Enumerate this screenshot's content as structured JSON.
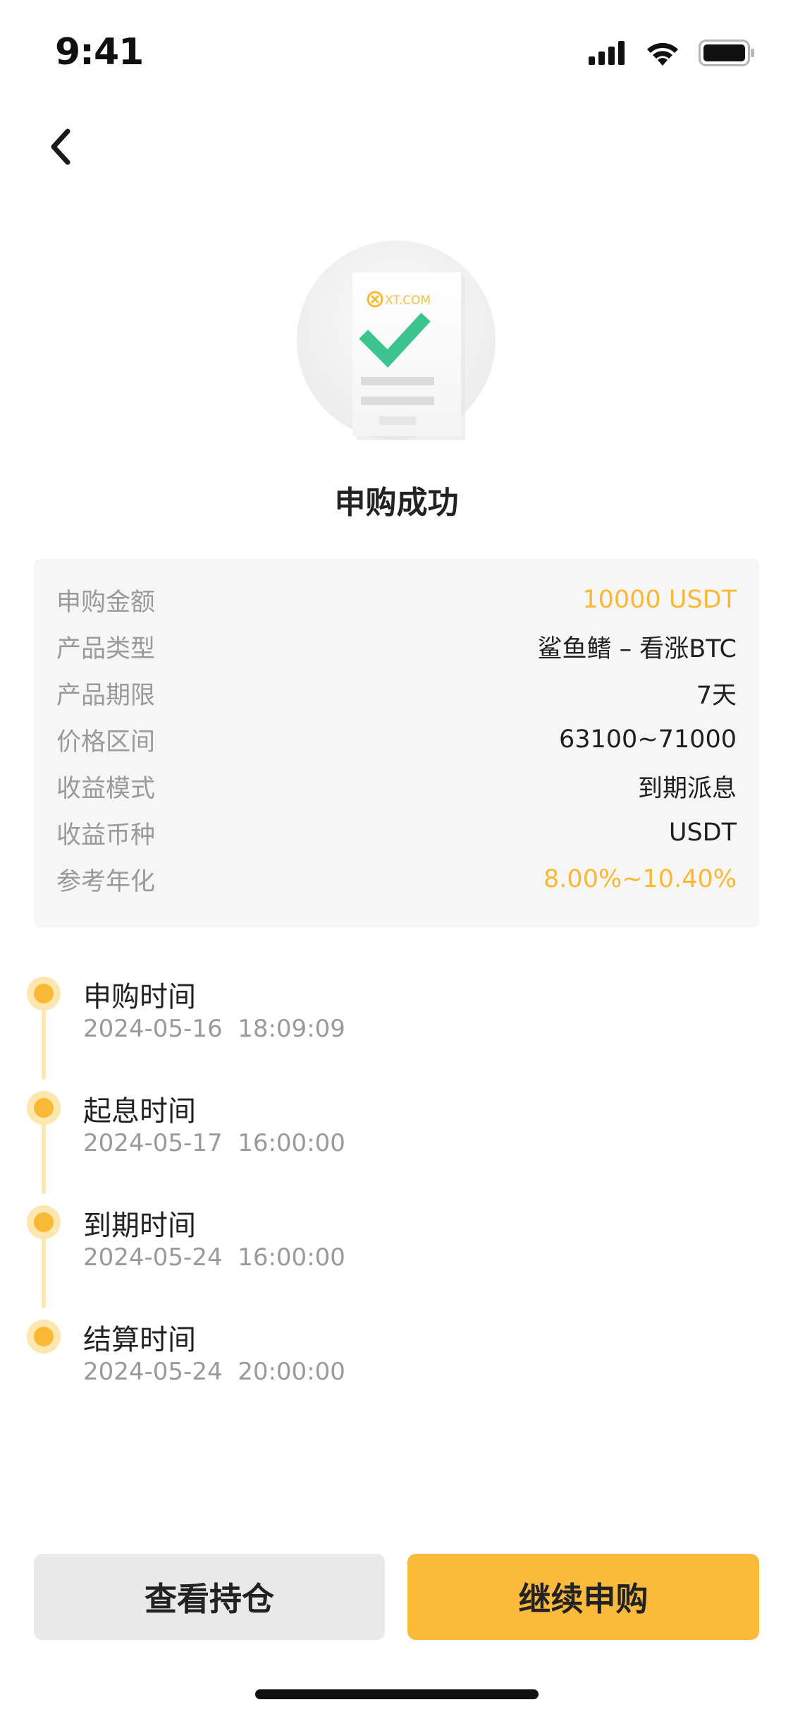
{
  "status_bar": {
    "time": "9:41"
  },
  "icons": {
    "back": "chevron-left-icon",
    "signal": "signal-icon",
    "wifi": "wifi-icon",
    "battery": "battery-icon"
  },
  "illustration": {
    "brand": "XT.COM"
  },
  "success": {
    "title": "申购成功"
  },
  "details": [
    {
      "label": "申购金额",
      "value": "10000 USDT",
      "accent": true
    },
    {
      "label": "产品类型",
      "value": "鲨鱼鳍 – 看涨BTC",
      "accent": false
    },
    {
      "label": "产品期限",
      "value": "7天",
      "accent": false
    },
    {
      "label": "价格区间",
      "value": "63100~71000",
      "accent": false
    },
    {
      "label": "收益模式",
      "value": "到期派息",
      "accent": false
    },
    {
      "label": "收益币种",
      "value": "USDT",
      "accent": false
    },
    {
      "label": "参考年化",
      "value": "8.00%~10.40%",
      "accent": true
    }
  ],
  "timeline": [
    {
      "title": "申购时间",
      "time": "2024-05-16  18:09:09"
    },
    {
      "title": "起息时间",
      "time": "2024-05-17  16:00:00"
    },
    {
      "title": "到期时间",
      "time": "2024-05-24  16:00:00"
    },
    {
      "title": "结算时间",
      "time": "2024-05-24  20:00:00"
    }
  ],
  "buttons": {
    "view_positions": "查看持仓",
    "continue_subscribe": "继续申购"
  },
  "colors": {
    "accent": "#F9B934",
    "button_primary": "#FBBA3C",
    "button_secondary": "#E9E9E9",
    "timeline_light": "#FDE7AE",
    "check_green": "#3CC48F"
  }
}
